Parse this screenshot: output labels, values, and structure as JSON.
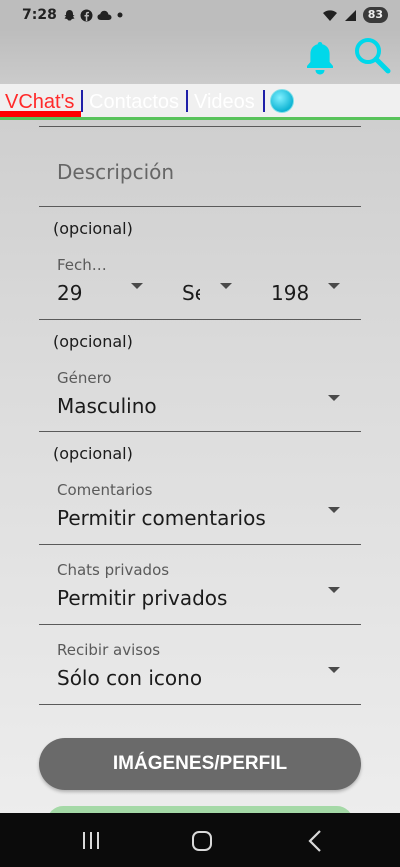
{
  "status_bar": {
    "time": "7:28",
    "battery": "83",
    "icons": [
      "snapchat-icon",
      "facebook-icon",
      "cloud-icon",
      "dot-icon",
      "wifi-icon",
      "signal-icon"
    ]
  },
  "app_bar": {
    "icons": [
      "bell-icon",
      "search-icon"
    ],
    "accent_color": "#00d8ea"
  },
  "tabs": [
    {
      "label": "VChat's",
      "active": true,
      "color": "#ff2a2a"
    },
    {
      "label": "Contactos",
      "active": false
    },
    {
      "label": "Videos",
      "active": false
    }
  ],
  "form": {
    "descripcion_placeholder": "Descripción",
    "fecha": {
      "optional_hint": "(opcional)",
      "label": "Fech…",
      "day": "29",
      "month": "Se",
      "year": "198"
    },
    "genero": {
      "optional_hint": "(opcional)",
      "label": "Género",
      "value": "Masculino"
    },
    "comentarios": {
      "optional_hint": "(opcional)",
      "label": "Comentarios",
      "value": "Permitir comentarios"
    },
    "chats_privados": {
      "label": "Chats privados",
      "value": "Permitir privados"
    },
    "recibir_avisos": {
      "label": "Recibir avisos",
      "value": "Sólo con icono"
    }
  },
  "buttons": {
    "images_profile": "IMÁGENES/PERFIL"
  },
  "nav_bar": {
    "icons": [
      "recent-apps-icon",
      "home-icon",
      "back-icon"
    ]
  }
}
